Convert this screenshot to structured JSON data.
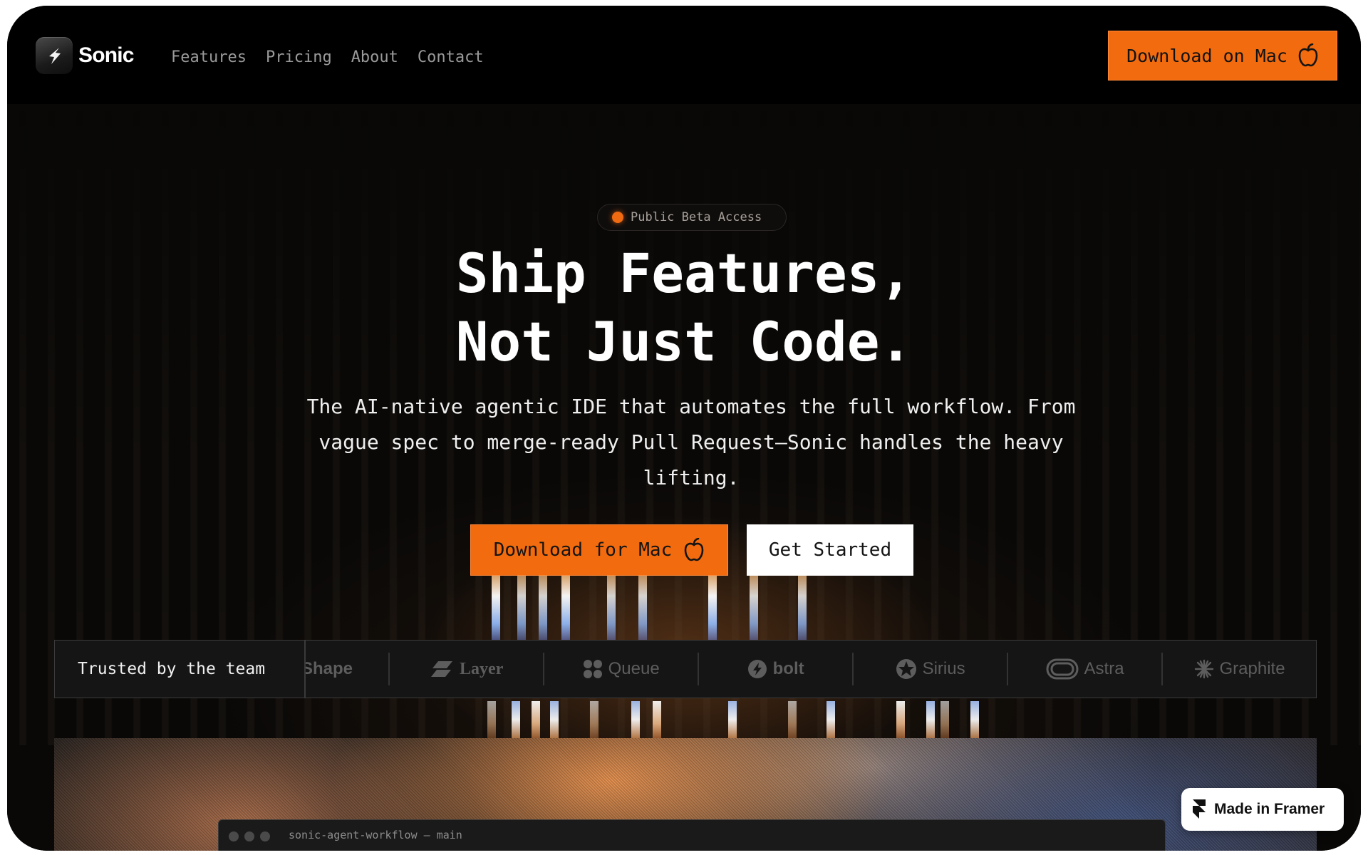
{
  "brand": {
    "name": "Sonic"
  },
  "nav": {
    "links": [
      "Features",
      "Pricing",
      "About",
      "Contact"
    ],
    "cta_label": "Download on Mac"
  },
  "hero": {
    "badge": "Public Beta Access",
    "title_line1": "Ship Features,",
    "title_line2": "Not Just Code.",
    "subtitle": "The AI-native agentic IDE that automates the full workflow. From vague spec to merge-ready Pull Request—Sonic handles the heavy lifting.",
    "primary_cta": "Download for Mac",
    "secondary_cta": "Get Started"
  },
  "trust": {
    "label": "Trusted by the team",
    "logos": [
      "Shape",
      "Layer",
      "Queue",
      "bolt",
      "Sirius",
      "Astra",
      "Graphite"
    ]
  },
  "showcase": {
    "editor_title": "sonic-agent-workflow — main"
  },
  "framer_badge": {
    "label": "Made in Framer"
  },
  "colors": {
    "accent": "#f26b0f",
    "background": "#000000",
    "badge_dot": "#f06a12",
    "text_primary": "#ffffff",
    "text_muted": "#9a9a9a"
  },
  "icons": [
    "sonic-logo-icon",
    "apple-icon",
    "framer-icon",
    "layer-logo-icon",
    "queue-logo-icon",
    "bolt-logo-icon",
    "sirius-logo-icon",
    "astra-logo-icon",
    "graphite-logo-icon"
  ]
}
